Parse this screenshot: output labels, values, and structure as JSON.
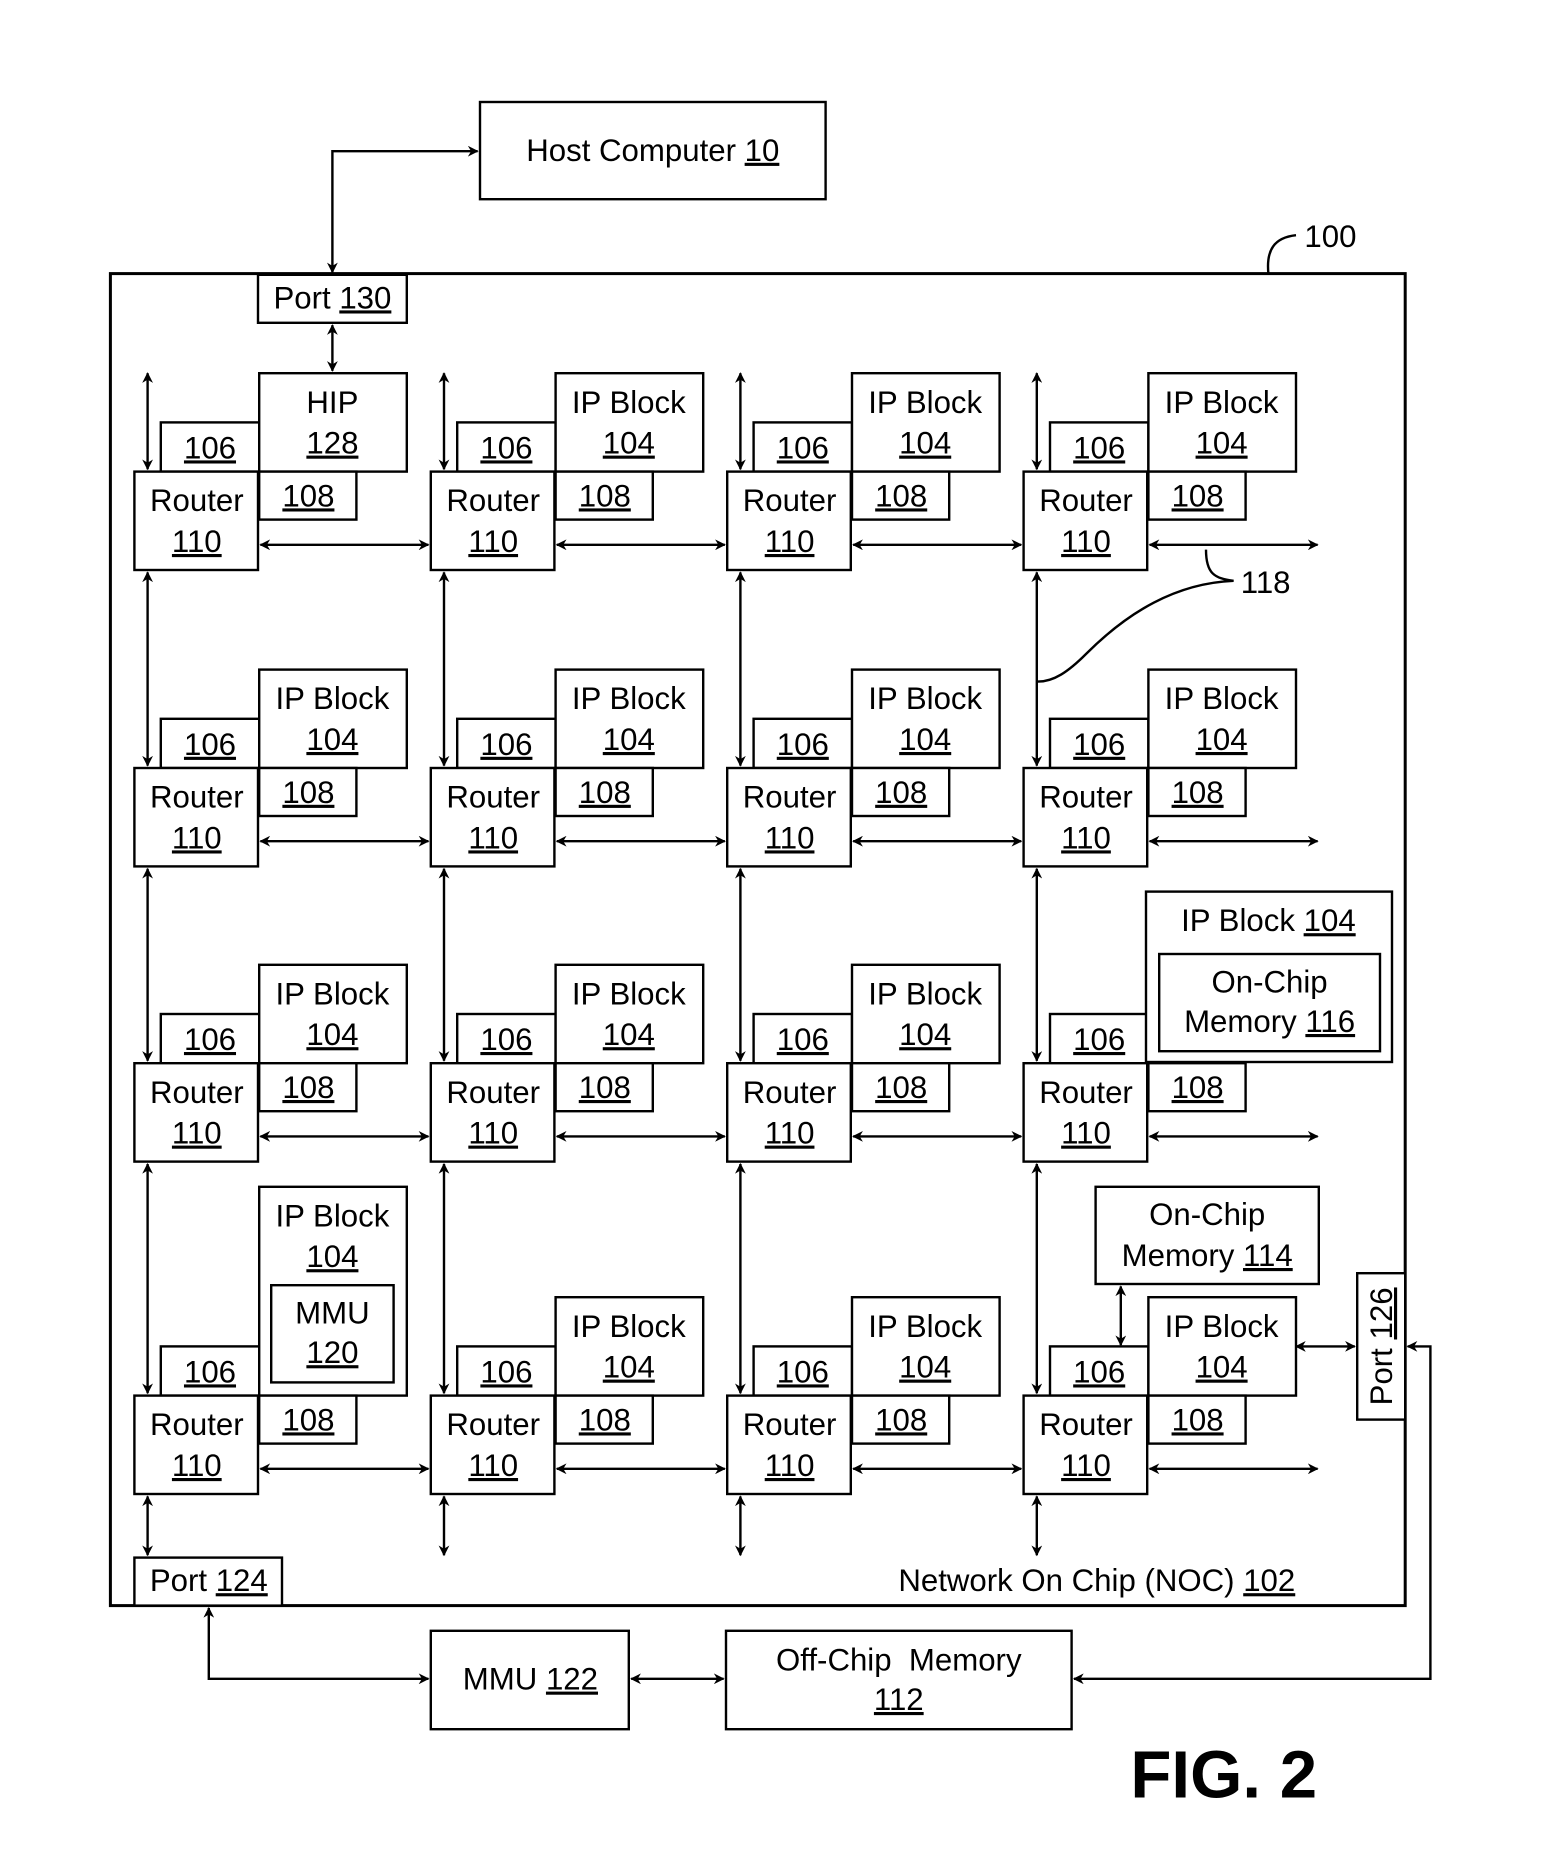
{
  "figure": {
    "label": "FIG. 2",
    "ref_chip": "100",
    "ref_links": "118"
  },
  "host": {
    "name": "Host Computer",
    "ref": "10"
  },
  "noc": {
    "name": "Network On Chip (NOC)",
    "ref": "102"
  },
  "ports": {
    "port130": {
      "name": "Port",
      "ref": "130"
    },
    "port124": {
      "name": "Port",
      "ref": "124"
    },
    "port126": {
      "name": "Port",
      "ref": "126"
    }
  },
  "router": {
    "name": "Router",
    "ref": "110"
  },
  "memory_comm_controller_ref": "106",
  "network_interface_controller_ref": "108",
  "ip_block": {
    "name": "IP Block",
    "ref": "104"
  },
  "hip": {
    "name": "HIP",
    "ref": "128"
  },
  "mmu_onchip": {
    "name": "MMU",
    "ref": "120"
  },
  "onchip_memory_116": {
    "line1": "On-Chip",
    "line2": "Memory",
    "ref": "116"
  },
  "onchip_memory_114": {
    "line1": "On-Chip",
    "line2": "Memory",
    "ref": "114"
  },
  "mmu_offchip": {
    "name": "MMU",
    "ref": "122"
  },
  "offchip_memory": {
    "name": "Off-Chip  Memory",
    "ref": "112"
  }
}
